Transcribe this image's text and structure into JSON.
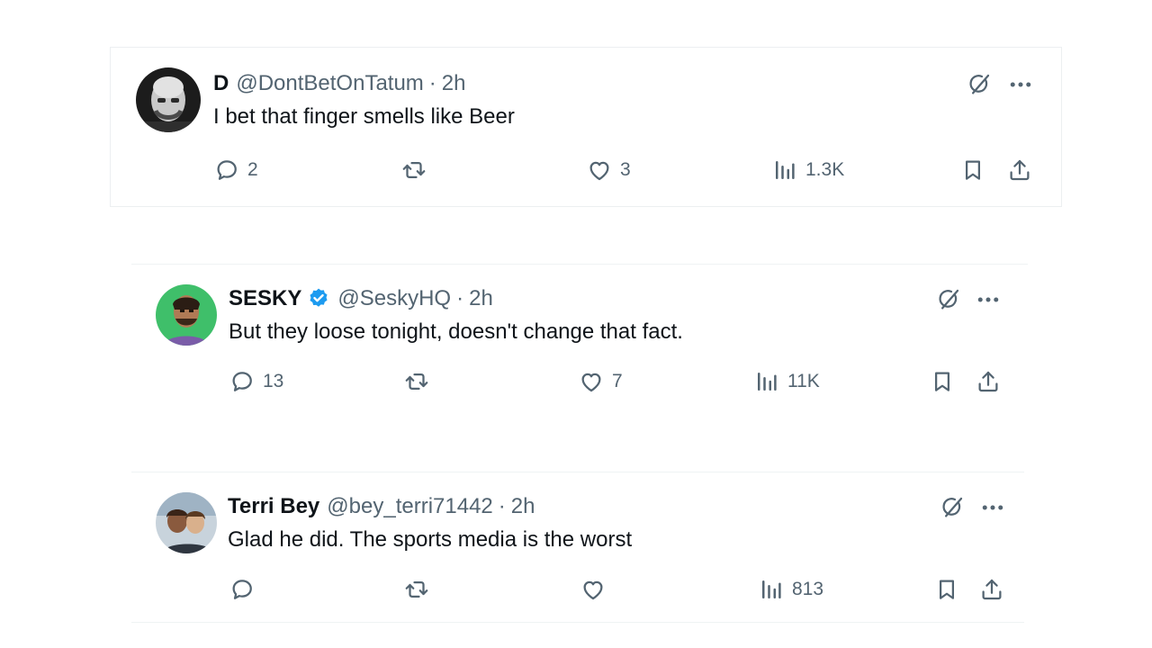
{
  "tweets": [
    {
      "name": "D",
      "handle": "@DontBetOnTatum",
      "separator": "·",
      "time": "2h",
      "text": "I bet that finger smells like Beer",
      "verified": false,
      "avatar_icon": "bald-man-photo",
      "replies": "2",
      "reposts": "",
      "likes": "3",
      "views": "1.3K"
    },
    {
      "name": "SESKY",
      "handle": "@SeskyHQ",
      "separator": "·",
      "time": "2h",
      "text": "But they loose tonight, doesn't change that fact.",
      "verified": true,
      "verified_color": "#1d9bf0",
      "avatar_icon": "man-green-background-photo",
      "replies": "13",
      "reposts": "",
      "likes": "7",
      "views": "11K"
    },
    {
      "name": "Terri Bey",
      "handle": "@bey_terri71442",
      "separator": "·",
      "time": "2h",
      "text": "Glad he did.  The sports media is the worst",
      "verified": false,
      "avatar_icon": "two-people-photo",
      "replies": "",
      "reposts": "",
      "likes": "",
      "views": "813"
    }
  ],
  "icons": {
    "reply": "speech-bubble-icon",
    "repost": "repost-arrows-icon",
    "like": "heart-icon",
    "views": "bar-chart-icon",
    "bookmark": "bookmark-icon",
    "share": "share-upload-icon",
    "grok": "grok-icon",
    "more": "more-dots-icon"
  },
  "colors": {
    "text": "#0f1419",
    "secondary": "#536471",
    "verified": "#1d9bf0",
    "border": "#eff3f4"
  }
}
